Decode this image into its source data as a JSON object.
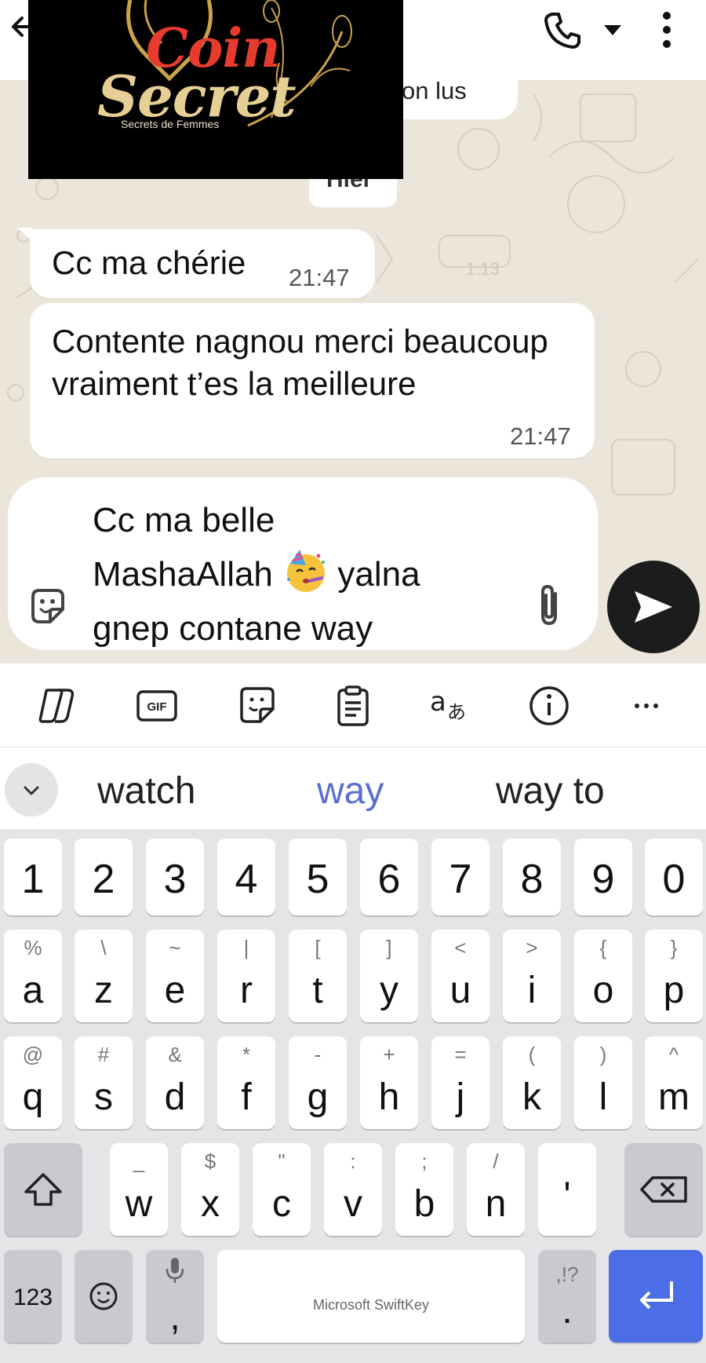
{
  "header": {
    "back_icon": "back-arrow-icon",
    "call_icon": "phone-icon",
    "call_menu_icon": "caret-down-icon",
    "more_icon": "more-vertical-icon"
  },
  "logo": {
    "line1": "Coin",
    "line2": "Secret",
    "tagline": "Secrets de Femmes"
  },
  "chat": {
    "unread_banner": "on lus",
    "date_chip": "Hier",
    "messages": [
      {
        "text": "Cc ma chérie",
        "time": "21:47"
      },
      {
        "text": "Contente nagnou merci beaucoup vraiment t’es la meilleure",
        "time": "21:47"
      }
    ]
  },
  "composer": {
    "line1": "Cc ma belle",
    "line2_a": "MashaAllah",
    "line2_b": "yalna",
    "line3": "gnep contane way",
    "emoji": "partying-face",
    "sticker_icon": "sticker-icon",
    "attach_icon": "paperclip-icon",
    "send_icon": "send-icon"
  },
  "keyboard_toolbar": {
    "icons": [
      "copilot-icon",
      "gif-icon",
      "sticker-icon",
      "clipboard-icon",
      "translate-icon",
      "info-icon",
      "more-horizontal-icon"
    ],
    "gif_label": "GIF"
  },
  "suggestions": {
    "items": [
      "watch",
      "way",
      "way to"
    ],
    "highlight_color": "#5b6fd0"
  },
  "keyboard": {
    "numbers": [
      "1",
      "2",
      "3",
      "4",
      "5",
      "6",
      "7",
      "8",
      "9",
      "0"
    ],
    "row1": [
      {
        "k": "a",
        "s": "%"
      },
      {
        "k": "z",
        "s": "\\"
      },
      {
        "k": "e",
        "s": "~"
      },
      {
        "k": "r",
        "s": "|"
      },
      {
        "k": "t",
        "s": "["
      },
      {
        "k": "y",
        "s": "]"
      },
      {
        "k": "u",
        "s": "<"
      },
      {
        "k": "i",
        "s": ">"
      },
      {
        "k": "o",
        "s": "{"
      },
      {
        "k": "p",
        "s": "}"
      }
    ],
    "row2": [
      {
        "k": "q",
        "s": "@"
      },
      {
        "k": "s",
        "s": "#"
      },
      {
        "k": "d",
        "s": "&"
      },
      {
        "k": "f",
        "s": "*"
      },
      {
        "k": "g",
        "s": "-"
      },
      {
        "k": "h",
        "s": "+"
      },
      {
        "k": "j",
        "s": "="
      },
      {
        "k": "k",
        "s": "("
      },
      {
        "k": "l",
        "s": ")"
      },
      {
        "k": "m",
        "s": "^"
      }
    ],
    "row3": [
      {
        "k": "w",
        "s": "_"
      },
      {
        "k": "x",
        "s": "$"
      },
      {
        "k": "c",
        "s": "\""
      },
      {
        "k": "v",
        "s": ":"
      },
      {
        "k": "b",
        "s": ";"
      },
      {
        "k": "n",
        "s": "/"
      },
      {
        "k": "'",
        "s": ""
      }
    ],
    "num_toggle": "123",
    "comma": ",",
    "period": ".",
    "period_sub": ",!?",
    "space_label": "Microsoft SwiftKey",
    "enter_color": "#4b6ee6"
  }
}
